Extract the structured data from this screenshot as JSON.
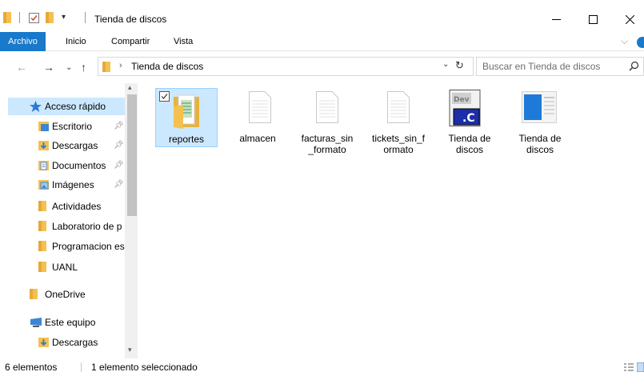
{
  "window": {
    "title": "Tienda de discos",
    "controls": [
      "minimize",
      "maximize",
      "close"
    ]
  },
  "ribbon": {
    "tabs": [
      {
        "label": "Archivo",
        "active": true
      },
      {
        "label": "Inicio"
      },
      {
        "label": "Compartir"
      },
      {
        "label": "Vista"
      }
    ]
  },
  "address": {
    "path": "Tienda de discos",
    "search_placeholder": "Buscar en Tienda de discos"
  },
  "nav_pane": {
    "items": [
      {
        "label": "Acceso rápido",
        "icon": "star-icon",
        "selected": true
      },
      {
        "label": "Escritorio",
        "icon": "desktop-folder-icon",
        "pinned": true
      },
      {
        "label": "Descargas",
        "icon": "downloads-folder-icon",
        "pinned": true
      },
      {
        "label": "Documentos",
        "icon": "documents-folder-icon",
        "pinned": true
      },
      {
        "label": "Imágenes",
        "icon": "pictures-folder-icon",
        "pinned": true
      },
      {
        "label": "Actividades",
        "icon": "folder-icon"
      },
      {
        "label": "Laboratorio de p",
        "icon": "folder-icon"
      },
      {
        "label": "Programacion es",
        "icon": "folder-icon"
      },
      {
        "label": "UANL",
        "icon": "folder-icon"
      },
      {
        "label": "OneDrive",
        "icon": "onedrive-folder-icon"
      },
      {
        "label": "Este equipo",
        "icon": "this-pc-icon"
      },
      {
        "label": "Descargas",
        "icon": "downloads-folder-icon"
      }
    ]
  },
  "files": [
    {
      "label": "reportes",
      "type": "folder",
      "selected": true
    },
    {
      "label": "almacen",
      "type": "file"
    },
    {
      "label": "facturas_sin\n_formato",
      "type": "file"
    },
    {
      "label": "tickets_sin_f\normato",
      "type": "file"
    },
    {
      "label": "Tienda de\ndiscos",
      "type": "c-source"
    },
    {
      "label": "Tienda de\ndiscos",
      "type": "project"
    }
  ],
  "status": {
    "count": "6 elementos",
    "selection": "1 elemento seleccionado"
  },
  "colors": {
    "accent": "#1979ca",
    "selection": "#cce8ff",
    "folder": "#f4c150"
  }
}
